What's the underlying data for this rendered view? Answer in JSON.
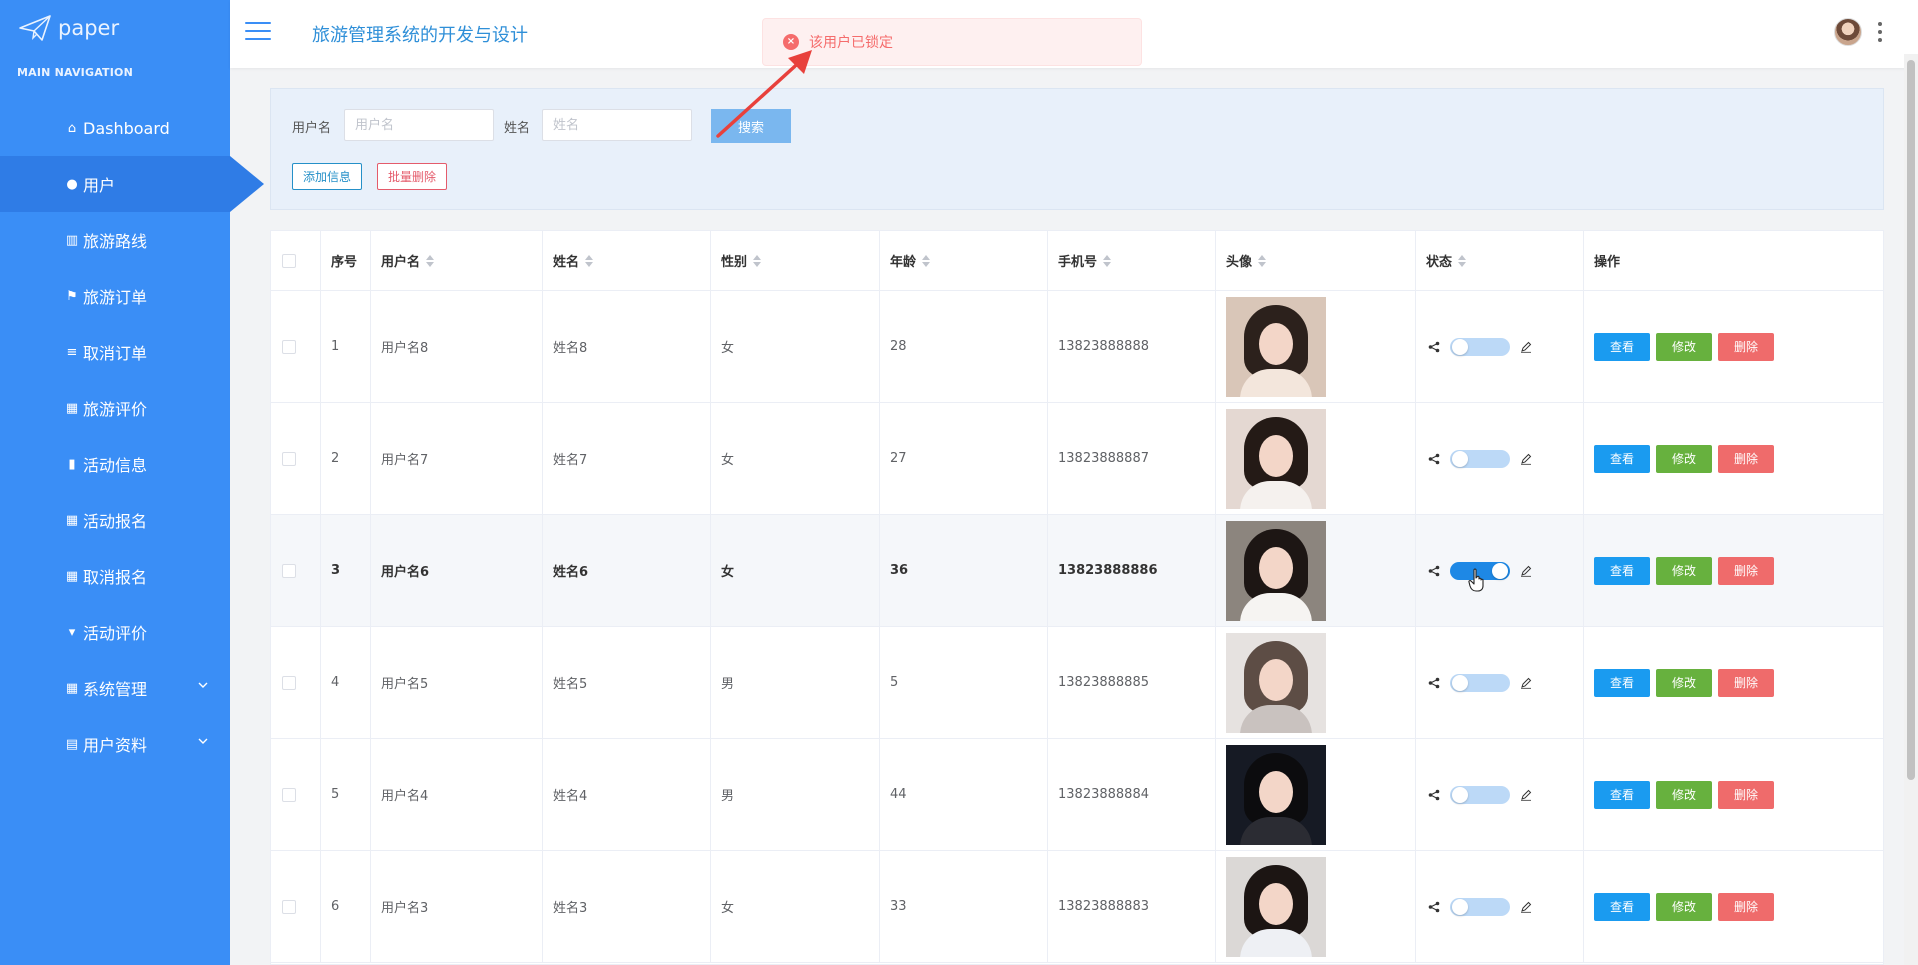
{
  "logo": {
    "text": "paper"
  },
  "sidebar": {
    "caption": "MAIN NAVIGATION",
    "items": [
      {
        "label": "Dashboard",
        "icon": "home-icon"
      },
      {
        "label": "用户",
        "icon": "user-icon"
      },
      {
        "label": "旅游路线",
        "icon": "library-icon"
      },
      {
        "label": "旅游订单",
        "icon": "flag-icon"
      },
      {
        "label": "取消订单",
        "icon": "sliders-icon"
      },
      {
        "label": "旅游评价",
        "icon": "grid-icon"
      },
      {
        "label": "活动信息",
        "icon": "bar-chart-icon"
      },
      {
        "label": "活动报名",
        "icon": "grid-icon"
      },
      {
        "label": "取消报名",
        "icon": "grid-icon"
      },
      {
        "label": "活动评价",
        "icon": "cup-icon"
      },
      {
        "label": "系统管理",
        "icon": "grid-icon"
      },
      {
        "label": "用户资料",
        "icon": "calendar-icon"
      }
    ]
  },
  "header": {
    "title": "旅游管理系统的开发与设计"
  },
  "toast": {
    "message": "该用户已锁定",
    "type": "error",
    "color": "#f56c6c"
  },
  "search": {
    "username_label": "用户名",
    "username_placeholder": "用户名",
    "name_label": "姓名",
    "name_placeholder": "姓名",
    "search_button": "搜索",
    "add_button": "添加信息",
    "batch_delete_button": "批量删除"
  },
  "table": {
    "columns": [
      "序号",
      "用户名",
      "姓名",
      "性别",
      "年龄",
      "手机号",
      "头像",
      "状态",
      "操作"
    ],
    "rows": [
      {
        "index": "1",
        "username": "用户名8",
        "name": "姓名8",
        "gender": "女",
        "age": "28",
        "phone": "13823888888",
        "locked": false
      },
      {
        "index": "2",
        "username": "用户名7",
        "name": "姓名7",
        "gender": "女",
        "age": "27",
        "phone": "13823888887",
        "locked": false
      },
      {
        "index": "3",
        "username": "用户名6",
        "name": "姓名6",
        "gender": "女",
        "age": "36",
        "phone": "13823888886",
        "locked": true
      },
      {
        "index": "4",
        "username": "用户名5",
        "name": "姓名5",
        "gender": "男",
        "age": "5",
        "phone": "13823888885",
        "locked": false
      },
      {
        "index": "5",
        "username": "用户名4",
        "name": "姓名4",
        "gender": "男",
        "age": "44",
        "phone": "13823888884",
        "locked": false
      },
      {
        "index": "6",
        "username": "用户名3",
        "name": "姓名3",
        "gender": "女",
        "age": "33",
        "phone": "13823888883",
        "locked": false
      }
    ],
    "actions": {
      "view": "查看",
      "edit": "修改",
      "delete": "删除"
    }
  },
  "colors": {
    "sidebar": "#3a8ef6",
    "sidebar_active": "#2f7ce6",
    "view": "#1a9bf0",
    "edit": "#67b13e",
    "delete": "#ef6b6b",
    "toggle_on": "#1e88e5",
    "toggle_off": "#bcd9f7"
  }
}
